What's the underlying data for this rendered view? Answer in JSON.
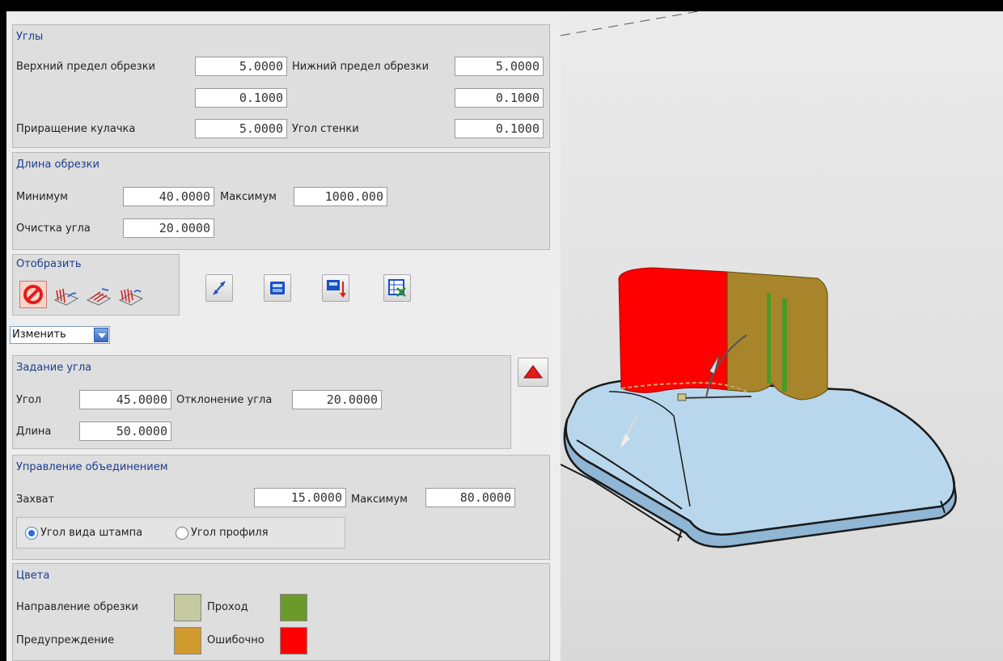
{
  "angles": {
    "title": "Углы",
    "upper_label": "Верхний предел обрезки",
    "upper_value": "5.0000",
    "lower_label": "Нижний предел обрезки",
    "lower_value": "5.0000",
    "upper_step": "0.1000",
    "lower_step": "0.1000",
    "cam_label": "Приращение кулачка",
    "cam_value": "5.0000",
    "wall_label": "Угол стенки",
    "wall_value": "0.1000"
  },
  "trim_length": {
    "title": "Длина обрезки",
    "min_label": "Минимум",
    "min_value": "40.0000",
    "max_label": "Максимум",
    "max_value": "1000.000",
    "corner_label": "Очистка угла",
    "corner_value": "20.0000"
  },
  "display": {
    "title": "Отобразить",
    "icons": [
      "no-display-icon",
      "trim-lines-icon",
      "trim-surface-icon",
      "trim-all-icon"
    ]
  },
  "toolbar": {
    "icons": [
      "direction-arrow-icon",
      "calculator-icon",
      "export-down-icon",
      "table-export-icon"
    ]
  },
  "mode_dropdown": {
    "value": "Изменить"
  },
  "angle_setting": {
    "title": "Задание угла",
    "angle_label": "Угол",
    "angle_value": "45.0000",
    "deviation_label": "Отклонение угла",
    "deviation_value": "20.0000",
    "length_label": "Длина",
    "length_value": "50.0000"
  },
  "merge_control": {
    "title": "Управление объединением",
    "grab_label": "Захват",
    "grab_value": "15.0000",
    "max_label": "Максимум",
    "max_value": "80.0000",
    "radio_die": "Угол вида штампа",
    "radio_profile": "Угол профиля",
    "selected": "die"
  },
  "colors": {
    "title": "Цвета",
    "direction_label": "Направление обрезки",
    "direction_color": "#c6c8a0",
    "pass_label": "Проход",
    "pass_color": "#6b9a2a",
    "warning_label": "Предупреждение",
    "warning_color": "#d19a2e",
    "error_label": "Ошибочно",
    "error_color": "#ff0000"
  }
}
